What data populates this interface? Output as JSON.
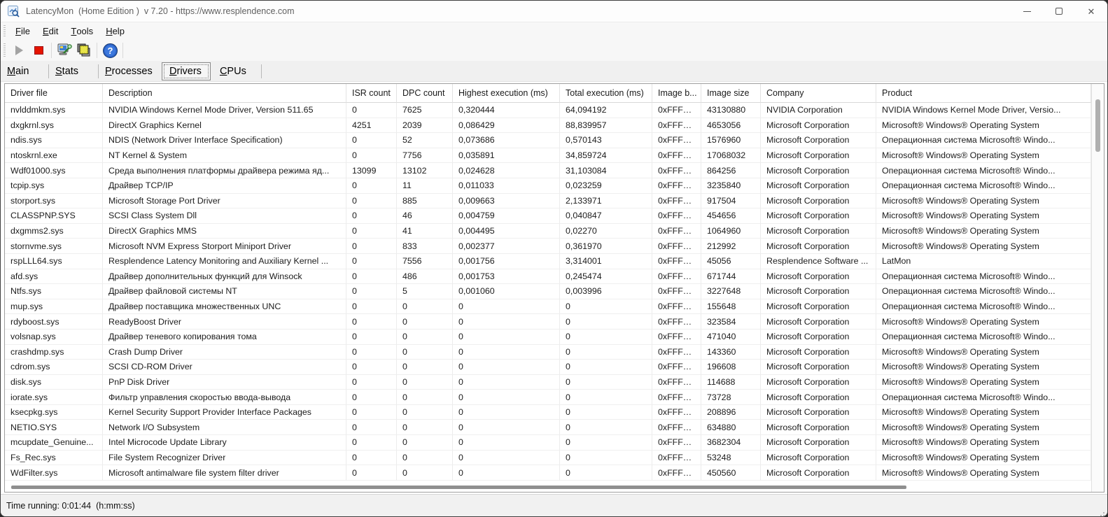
{
  "window": {
    "title": "LatencyMon  (Home Edition )  v 7.20 - https://www.resplendence.com"
  },
  "menu": {
    "items": [
      "File",
      "Edit",
      "Tools",
      "Help"
    ]
  },
  "toolbar": {
    "icons": [
      "play-icon",
      "stop-icon",
      "monitor-report-icon",
      "copy-screenshot-icon",
      "help-icon"
    ]
  },
  "tabs": {
    "items": [
      "Main",
      "Stats",
      "Processes",
      "Drivers",
      "CPUs"
    ],
    "active": "Drivers"
  },
  "colors": {
    "stop_button": "#e51400",
    "help_icon": "#2d64c8",
    "copy_icon_yellow": "#f2ef3a"
  },
  "table": {
    "columns": [
      "Driver file",
      "Description",
      "ISR count",
      "DPC count",
      "Highest execution (ms)",
      "Total execution (ms)",
      "Image b...",
      "Image size",
      "Company",
      "Product"
    ],
    "rows": [
      [
        "nvlddmkm.sys",
        "NVIDIA Windows Kernel Mode Driver, Version 511.65",
        "0",
        "7625",
        "0,320444",
        "64,094192",
        "0xFFFFF...",
        "43130880",
        "NVIDIA Corporation",
        "NVIDIA Windows Kernel Mode Driver, Versio..."
      ],
      [
        "dxgkrnl.sys",
        "DirectX Graphics Kernel",
        "4251",
        "2039",
        "0,086429",
        "88,839957",
        "0xFFFFF...",
        "4653056",
        "Microsoft Corporation",
        "Microsoft® Windows® Operating System"
      ],
      [
        "ndis.sys",
        "NDIS (Network Driver Interface Specification)",
        "0",
        "52",
        "0,073686",
        "0,570143",
        "0xFFFFF...",
        "1576960",
        "Microsoft Corporation",
        "Операционная система Microsoft® Windo..."
      ],
      [
        "ntoskrnl.exe",
        "NT Kernel & System",
        "0",
        "7756",
        "0,035891",
        "34,859724",
        "0xFFFFF...",
        "17068032",
        "Microsoft Corporation",
        "Microsoft® Windows® Operating System"
      ],
      [
        "Wdf01000.sys",
        "Среда выполнения платформы драйвера режима яд...",
        "13099",
        "13102",
        "0,024628",
        "31,103084",
        "0xFFFFF...",
        "864256",
        "Microsoft Corporation",
        "Операционная система Microsoft® Windo..."
      ],
      [
        "tcpip.sys",
        "Драйвер TCP/IP",
        "0",
        "11",
        "0,011033",
        "0,023259",
        "0xFFFFF...",
        "3235840",
        "Microsoft Corporation",
        "Операционная система Microsoft® Windo..."
      ],
      [
        "storport.sys",
        "Microsoft Storage Port Driver",
        "0",
        "885",
        "0,009663",
        "2,133971",
        "0xFFFFF...",
        "917504",
        "Microsoft Corporation",
        "Microsoft® Windows® Operating System"
      ],
      [
        "CLASSPNP.SYS",
        "SCSI Class System Dll",
        "0",
        "46",
        "0,004759",
        "0,040847",
        "0xFFFFF...",
        "454656",
        "Microsoft Corporation",
        "Microsoft® Windows® Operating System"
      ],
      [
        "dxgmms2.sys",
        "DirectX Graphics MMS",
        "0",
        "41",
        "0,004495",
        "0,02270",
        "0xFFFFF...",
        "1064960",
        "Microsoft Corporation",
        "Microsoft® Windows® Operating System"
      ],
      [
        "stornvme.sys",
        "Microsoft NVM Express Storport Miniport Driver",
        "0",
        "833",
        "0,002377",
        "0,361970",
        "0xFFFFF...",
        "212992",
        "Microsoft Corporation",
        "Microsoft® Windows® Operating System"
      ],
      [
        "rspLLL64.sys",
        "Resplendence Latency Monitoring and Auxiliary Kernel ...",
        "0",
        "7556",
        "0,001756",
        "3,314001",
        "0xFFFFF...",
        "45056",
        "Resplendence Software ...",
        "LatMon"
      ],
      [
        "afd.sys",
        "Драйвер дополнительных функций для Winsock",
        "0",
        "486",
        "0,001753",
        "0,245474",
        "0xFFFFF...",
        "671744",
        "Microsoft Corporation",
        "Операционная система Microsoft® Windo..."
      ],
      [
        "Ntfs.sys",
        "Драйвер файловой системы NT",
        "0",
        "5",
        "0,001060",
        "0,003996",
        "0xFFFFF...",
        "3227648",
        "Microsoft Corporation",
        "Операционная система Microsoft® Windo..."
      ],
      [
        "mup.sys",
        "Драйвер поставщика множественных UNC",
        "0",
        "0",
        "0",
        "0",
        "0xFFFFF...",
        "155648",
        "Microsoft Corporation",
        "Операционная система Microsoft® Windo..."
      ],
      [
        "rdyboost.sys",
        "ReadyBoost Driver",
        "0",
        "0",
        "0",
        "0",
        "0xFFFFF...",
        "323584",
        "Microsoft Corporation",
        "Microsoft® Windows® Operating System"
      ],
      [
        "volsnap.sys",
        "Драйвер теневого копирования тома",
        "0",
        "0",
        "0",
        "0",
        "0xFFFFF...",
        "471040",
        "Microsoft Corporation",
        "Операционная система Microsoft® Windo..."
      ],
      [
        "crashdmp.sys",
        "Crash Dump Driver",
        "0",
        "0",
        "0",
        "0",
        "0xFFFFF...",
        "143360",
        "Microsoft Corporation",
        "Microsoft® Windows® Operating System"
      ],
      [
        "cdrom.sys",
        "SCSI CD-ROM Driver",
        "0",
        "0",
        "0",
        "0",
        "0xFFFFF...",
        "196608",
        "Microsoft Corporation",
        "Microsoft® Windows® Operating System"
      ],
      [
        "disk.sys",
        "PnP Disk Driver",
        "0",
        "0",
        "0",
        "0",
        "0xFFFFF...",
        "114688",
        "Microsoft Corporation",
        "Microsoft® Windows® Operating System"
      ],
      [
        "iorate.sys",
        "Фильтр управления скоростью ввода-вывода",
        "0",
        "0",
        "0",
        "0",
        "0xFFFFF...",
        "73728",
        "Microsoft Corporation",
        "Операционная система Microsoft® Windo..."
      ],
      [
        "ksecpkg.sys",
        "Kernel Security Support Provider Interface Packages",
        "0",
        "0",
        "0",
        "0",
        "0xFFFFF...",
        "208896",
        "Microsoft Corporation",
        "Microsoft® Windows® Operating System"
      ],
      [
        "NETIO.SYS",
        "Network I/O Subsystem",
        "0",
        "0",
        "0",
        "0",
        "0xFFFFF...",
        "634880",
        "Microsoft Corporation",
        "Microsoft® Windows® Operating System"
      ],
      [
        "mcupdate_Genuine...",
        "Intel Microcode Update Library",
        "0",
        "0",
        "0",
        "0",
        "0xFFFFF...",
        "3682304",
        "Microsoft Corporation",
        "Microsoft® Windows® Operating System"
      ],
      [
        "Fs_Rec.sys",
        "File System Recognizer Driver",
        "0",
        "0",
        "0",
        "0",
        "0xFFFFF...",
        "53248",
        "Microsoft Corporation",
        "Microsoft® Windows® Operating System"
      ],
      [
        "WdFilter.sys",
        "Microsoft antimalware file system filter driver",
        "0",
        "0",
        "0",
        "0",
        "0xFFFFF...",
        "450560",
        "Microsoft Corporation",
        "Microsoft® Windows® Operating System"
      ]
    ]
  },
  "status_bar": {
    "text": "Time running: 0:01:44  (h:mm:ss)"
  }
}
